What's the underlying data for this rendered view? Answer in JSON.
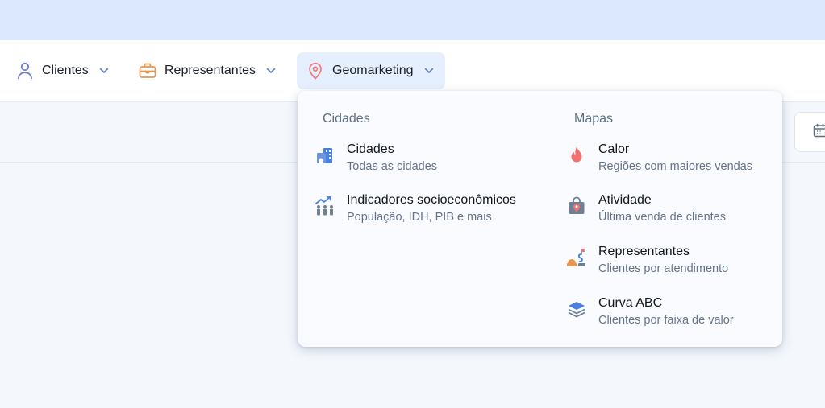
{
  "nav": {
    "items": [
      {
        "label": "Clientes",
        "icon": "user-icon"
      },
      {
        "label": "Representantes",
        "icon": "briefcase-icon"
      },
      {
        "label": "Geomarketing",
        "icon": "map-pin-icon",
        "active": true
      }
    ]
  },
  "dropdown": {
    "cidades": {
      "title": "Cidades",
      "items": [
        {
          "title": "Cidades",
          "subtitle": "Todas as cidades",
          "icon": "city-buildings-icon"
        },
        {
          "title": "Indicadores socioeconômicos",
          "subtitle": "População, IDH, PIB e mais",
          "icon": "population-chart-icon"
        }
      ]
    },
    "mapas": {
      "title": "Mapas",
      "items": [
        {
          "title": "Calor",
          "subtitle": "Regiões com maiores vendas",
          "icon": "flame-icon"
        },
        {
          "title": "Atividade",
          "subtitle": "Última venda de clientes",
          "icon": "shopping-bag-pin-icon"
        },
        {
          "title": "Representantes",
          "subtitle": "Clientes por atendimento",
          "icon": "route-flag-icon"
        },
        {
          "title": "Curva ABC",
          "subtitle": "Clientes por faixa de valor",
          "icon": "layers-icon"
        }
      ]
    }
  },
  "colors": {
    "accent": "#e6effd",
    "top_band": "#dbe8fd",
    "nav_user_icon": "#6b7cc9",
    "nav_briefcase_icon": "#e8954f",
    "nav_pin_icon": "#f07a7a",
    "flame": "#f07171",
    "blue_icon": "#4a7fe0"
  }
}
